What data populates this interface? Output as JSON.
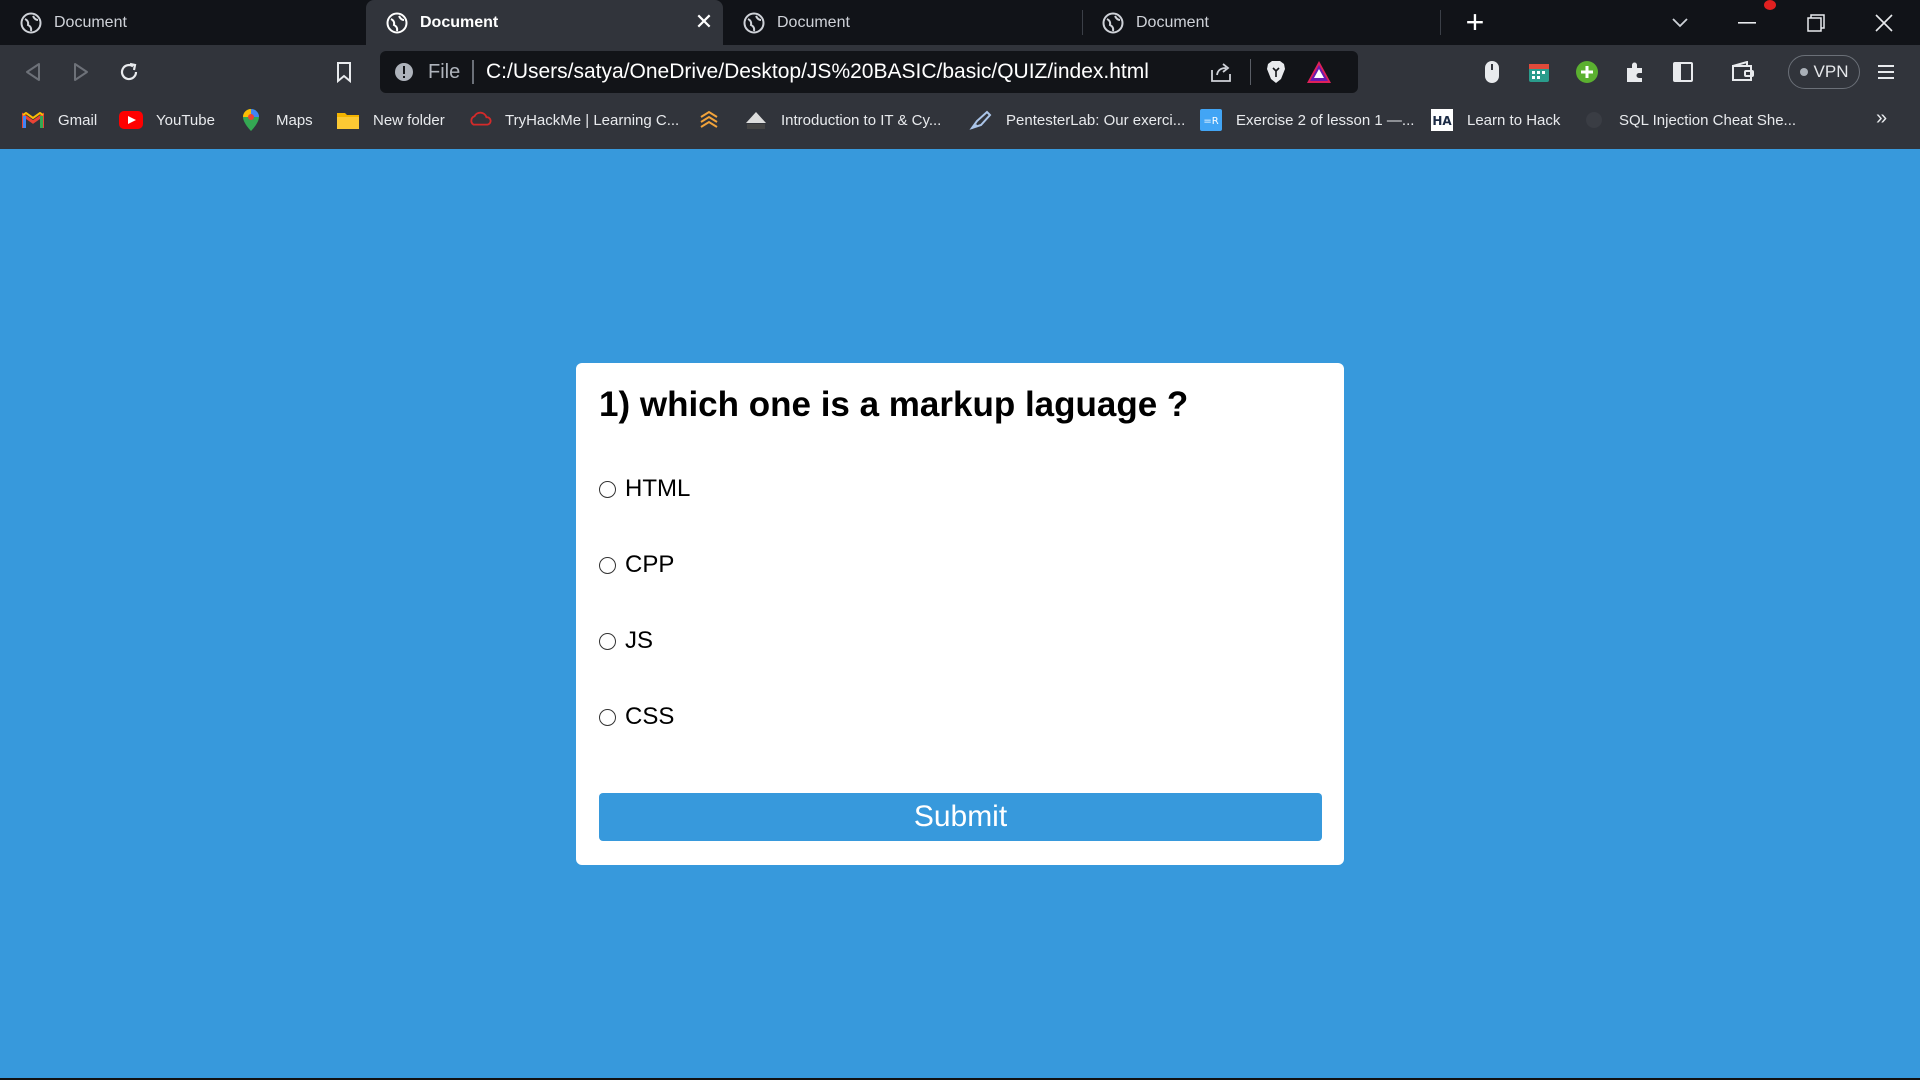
{
  "tabs": [
    {
      "title": "Document",
      "active": false
    },
    {
      "title": "Document",
      "active": true
    },
    {
      "title": "Document",
      "active": false
    },
    {
      "title": "Document",
      "active": false
    }
  ],
  "toolbar": {
    "scheme_label": "File",
    "url": "C:/Users/satya/OneDrive/Desktop/JS%20BASIC/basic/QUIZ/index.html",
    "vpn_label": "VPN"
  },
  "bookmarks": [
    {
      "label": "Gmail",
      "icon": "gmail-icon"
    },
    {
      "label": "YouTube",
      "icon": "youtube-icon"
    },
    {
      "label": "Maps",
      "icon": "maps-icon"
    },
    {
      "label": "New folder",
      "icon": "folder-icon"
    },
    {
      "label": "TryHackMe | Learning C...",
      "icon": "tryhackme-icon"
    },
    {
      "label": "",
      "icon": "stack-icon"
    },
    {
      "label": "Introduction to IT & Cy...",
      "icon": "cybrary-icon"
    },
    {
      "label": "PentesterLab: Our exerci...",
      "icon": "pentesterlab-icon"
    },
    {
      "label": "Exercise 2 of lesson 1 —...",
      "icon": "exercise-icon"
    },
    {
      "label": "Learn to Hack",
      "icon": "hackaday-icon"
    },
    {
      "label": "SQL Injection Cheat She...",
      "icon": "sql-icon"
    }
  ],
  "quiz": {
    "question": "1) which one is a markup laguage ?",
    "options": [
      "HTML",
      "CPP",
      "JS",
      "CSS"
    ],
    "submit_label": "Submit"
  },
  "colors": {
    "page_background": "#3799dc",
    "button": "#3799dc",
    "tabstrip": "#111318",
    "toolbar": "#31343b"
  }
}
